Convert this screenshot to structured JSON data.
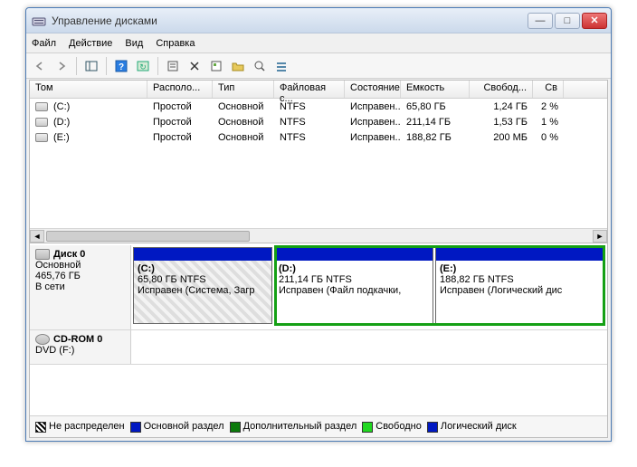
{
  "window": {
    "title": "Управление дисками"
  },
  "menu": {
    "file": "Файл",
    "action": "Действие",
    "view": "Вид",
    "help": "Справка"
  },
  "list": {
    "headers": {
      "volume": "Том",
      "layout": "Располо...",
      "type": "Тип",
      "fs": "Файловая с...",
      "status": "Состояние",
      "capacity": "Емкость",
      "free": "Свобод...",
      "pct": "Св"
    },
    "rows": [
      {
        "volume": "(C:)",
        "layout": "Простой",
        "type": "Основной",
        "fs": "NTFS",
        "status": "Исправен...",
        "capacity": "65,80 ГБ",
        "free": "1,24 ГБ",
        "pct": "2 %"
      },
      {
        "volume": "(D:)",
        "layout": "Простой",
        "type": "Основной",
        "fs": "NTFS",
        "status": "Исправен...",
        "capacity": "211,14 ГБ",
        "free": "1,53 ГБ",
        "pct": "1 %"
      },
      {
        "volume": "(E:)",
        "layout": "Простой",
        "type": "Основной",
        "fs": "NTFS",
        "status": "Исправен...",
        "capacity": "188,82 ГБ",
        "free": "200 МБ",
        "pct": "0 %"
      }
    ]
  },
  "disks": {
    "disk0": {
      "title": "Диск 0",
      "type": "Основной",
      "capacity": "465,76 ГБ",
      "status": "В сети",
      "partitions": [
        {
          "label": "(C:)",
          "line2": "65,80 ГБ NTFS",
          "line3": "Исправен (Система, Загр"
        },
        {
          "label": "(D:)",
          "line2": "211,14 ГБ NTFS",
          "line3": "Исправен (Файл подкачки,"
        },
        {
          "label": "(E:)",
          "line2": "188,82 ГБ NTFS",
          "line3": "Исправен (Логический дис"
        }
      ]
    },
    "cdrom": {
      "title": "CD-ROM 0",
      "sub": "DVD (F:)"
    }
  },
  "legend": {
    "unalloc": "Не распределен",
    "primary": "Основной раздел",
    "extended": "Дополнительный раздел",
    "free": "Свободно",
    "logical": "Логический диск"
  },
  "colors": {
    "primary": "#0018c2",
    "extended": "#0b7a0b",
    "free": "#20d820",
    "logical": "#0018c2",
    "unalloc_bg": "#000",
    "unalloc_pattern": "diag"
  }
}
